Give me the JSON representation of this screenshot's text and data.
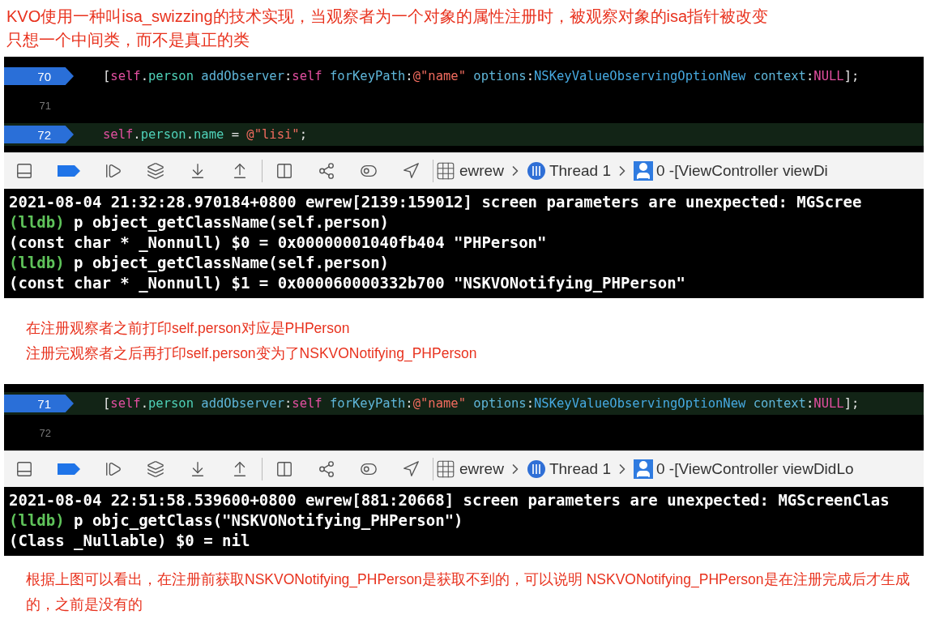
{
  "heading": [
    "KVO使用一种叫isa_swizzing的技术实现，当观察者为一个对象的属性注册时，被观察对象的isa指针被改变",
    "只想一个中间类，而不是真正的类"
  ],
  "panels": [
    {
      "code": [
        {
          "number": "70",
          "breakpoint": true,
          "current": false,
          "tokens": [
            {
              "kind": "plain",
              "text": "["
            },
            {
              "kind": "keyword",
              "text": "self"
            },
            {
              "kind": "plain",
              "text": "."
            },
            {
              "kind": "prop",
              "text": "person"
            },
            {
              "kind": "method",
              "text": " addObserver"
            },
            {
              "kind": "plain",
              "text": ":"
            },
            {
              "kind": "keyword",
              "text": "self"
            },
            {
              "kind": "method",
              "text": " forKeyPath"
            },
            {
              "kind": "plain",
              "text": ":"
            },
            {
              "kind": "string",
              "text": "@\"name\""
            },
            {
              "kind": "method",
              "text": " options"
            },
            {
              "kind": "plain",
              "text": ":"
            },
            {
              "kind": "const",
              "text": "NSKeyValueObservingOptionNew"
            },
            {
              "kind": "method",
              "text": " context"
            },
            {
              "kind": "plain",
              "text": ":"
            },
            {
              "kind": "keyword",
              "text": "NULL"
            },
            {
              "kind": "plain",
              "text": "];"
            }
          ]
        },
        {
          "number": "71",
          "breakpoint": false,
          "current": false
        },
        {
          "number": "72",
          "breakpoint": true,
          "current": true,
          "tokens": [
            {
              "kind": "keyword",
              "text": "self"
            },
            {
              "kind": "plain",
              "text": "."
            },
            {
              "kind": "prop",
              "text": "person"
            },
            {
              "kind": "plain",
              "text": "."
            },
            {
              "kind": "prop",
              "text": "name"
            },
            {
              "kind": "plain",
              "text": " = "
            },
            {
              "kind": "string",
              "text": "@\"lisi\""
            },
            {
              "kind": "plain",
              "text": ";"
            }
          ]
        }
      ],
      "breadcrumb": {
        "app": "ewrew",
        "thread": "Thread 1",
        "frame": "0 -[ViewController viewDi"
      },
      "console": [
        {
          "kind": "log",
          "text": "2021-08-04 21:32:28.970184+0800 ewrew[2139:159012] screen parameters are unexpected: MGScree"
        },
        {
          "kind": "command",
          "prompt": "(lldb)",
          "text": "p object_getClassName(self.person)"
        },
        {
          "kind": "log",
          "text": "(const char * _Nonnull) $0 = 0x00000001040fb404 \"PHPerson\""
        },
        {
          "kind": "command",
          "prompt": "(lldb)",
          "text": "p object_getClassName(self.person)"
        },
        {
          "kind": "log",
          "text": "(const char * _Nonnull) $1 = 0x000060000332b700 \"NSKVONotifying_PHPerson\""
        }
      ],
      "notes": [
        "在注册观察者之前打印self.person对应是PHPerson",
        "注册完观察者之后再打印self.person变为了NSKVONotifying_PHPerson"
      ]
    },
    {
      "code": [
        {
          "number": "71",
          "breakpoint": true,
          "current": true,
          "tokens": [
            {
              "kind": "plain",
              "text": "["
            },
            {
              "kind": "keyword",
              "text": "self"
            },
            {
              "kind": "plain",
              "text": "."
            },
            {
              "kind": "prop",
              "text": "person"
            },
            {
              "kind": "method",
              "text": " addObserver"
            },
            {
              "kind": "plain",
              "text": ":"
            },
            {
              "kind": "keyword",
              "text": "self"
            },
            {
              "kind": "method",
              "text": " forKeyPath"
            },
            {
              "kind": "plain",
              "text": ":"
            },
            {
              "kind": "string",
              "text": "@\"name\""
            },
            {
              "kind": "method",
              "text": " options"
            },
            {
              "kind": "plain",
              "text": ":"
            },
            {
              "kind": "const",
              "text": "NSKeyValueObservingOptionNew"
            },
            {
              "kind": "method",
              "text": " context"
            },
            {
              "kind": "plain",
              "text": ":"
            },
            {
              "kind": "keyword",
              "text": "NULL"
            },
            {
              "kind": "plain",
              "text": "];"
            }
          ]
        },
        {
          "number": "72",
          "breakpoint": false,
          "current": false
        }
      ],
      "breadcrumb": {
        "app": "ewrew",
        "thread": "Thread 1",
        "frame": "0 -[ViewController viewDidLo"
      },
      "console": [
        {
          "kind": "log",
          "text": "2021-08-04 22:51:58.539600+0800 ewrew[881:20668] screen parameters are unexpected: MGScreenClas"
        },
        {
          "kind": "command",
          "prompt": "(lldb)",
          "text": "p objc_getClass(\"NSKVONotifying_PHPerson\")"
        },
        {
          "kind": "log",
          "text": "(Class _Nullable) $0 = nil"
        }
      ],
      "notes": [
        "根据上图可以看出，在注册前获取NSKVONotifying_PHPerson是获取不到的，可以说明 NSKVONotifying_PHPerson是在注册完成后才生成的，之前是没有的"
      ]
    }
  ]
}
